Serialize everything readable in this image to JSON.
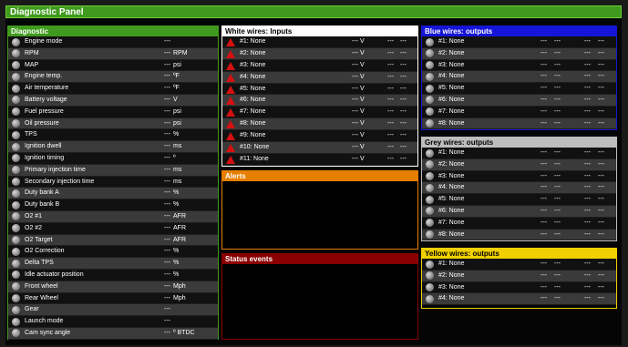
{
  "title": "Diagnostic Panel",
  "colors": {
    "green": "#3f9a1d",
    "white": "#ffffff",
    "orange": "#e67e00",
    "darkred": "#8a0000",
    "blue": "#1515d8",
    "grey": "#bdbdbd",
    "yellow": "#f0d000"
  },
  "diagnostic": {
    "title": "Diagnostic",
    "rows": [
      {
        "label": "Engine mode",
        "value": "---",
        "unit": ""
      },
      {
        "label": "RPM",
        "value": "---",
        "unit": "RPM"
      },
      {
        "label": "MAP",
        "value": "---",
        "unit": "psi"
      },
      {
        "label": "Engine temp.",
        "value": "---",
        "unit": "ºF"
      },
      {
        "label": "Air temperature",
        "value": "---",
        "unit": "ºF"
      },
      {
        "label": "Battery voltage",
        "value": "---",
        "unit": "V"
      },
      {
        "label": "Fuel pressure",
        "value": "---",
        "unit": "psi"
      },
      {
        "label": "Oil pressure",
        "value": "---",
        "unit": "psi"
      },
      {
        "label": "TPS",
        "value": "---",
        "unit": "%"
      },
      {
        "label": "Ignition dwell",
        "value": "---",
        "unit": "ms"
      },
      {
        "label": "Ignition timing",
        "value": "---",
        "unit": "º"
      },
      {
        "label": "Primary injection time",
        "value": "---",
        "unit": "ms"
      },
      {
        "label": "Secondary injection time",
        "value": "---",
        "unit": "ms"
      },
      {
        "label": "Duty bank A",
        "value": "---",
        "unit": "%"
      },
      {
        "label": "Duty bank B",
        "value": "---",
        "unit": "%"
      },
      {
        "label": "O2 #1",
        "value": "---",
        "unit": "AFR"
      },
      {
        "label": "O2 #2",
        "value": "---",
        "unit": "AFR"
      },
      {
        "label": "O2 Target",
        "value": "---",
        "unit": "AFR"
      },
      {
        "label": "O2 Correction",
        "value": "---",
        "unit": "%"
      },
      {
        "label": "Delta TPS",
        "value": "---",
        "unit": "%"
      },
      {
        "label": "Idle actuator position",
        "value": "---",
        "unit": "%"
      },
      {
        "label": "Front wheel",
        "value": "---",
        "unit": "Mph"
      },
      {
        "label": "Rear Wheel",
        "value": "---",
        "unit": "Mph"
      },
      {
        "label": "Gear",
        "value": "---",
        "unit": ""
      },
      {
        "label": "Launch mode",
        "value": "---",
        "unit": ""
      },
      {
        "label": "Cam sync angle",
        "value": "---",
        "unit": "º BTDC"
      }
    ]
  },
  "white_wires": {
    "title": "White wires: Inputs",
    "rows": [
      {
        "label": "#1: None",
        "v": "--- V",
        "a": "---",
        "b": "---"
      },
      {
        "label": "#2: None",
        "v": "--- V",
        "a": "---",
        "b": "---"
      },
      {
        "label": "#3: None",
        "v": "--- V",
        "a": "---",
        "b": "---"
      },
      {
        "label": "#4: None",
        "v": "--- V",
        "a": "---",
        "b": "---"
      },
      {
        "label": "#5: None",
        "v": "--- V",
        "a": "---",
        "b": "---"
      },
      {
        "label": "#6: None",
        "v": "--- V",
        "a": "---",
        "b": "---"
      },
      {
        "label": "#7: None",
        "v": "--- V",
        "a": "---",
        "b": "---"
      },
      {
        "label": "#8: None",
        "v": "--- V",
        "a": "---",
        "b": "---"
      },
      {
        "label": "#9: None",
        "v": "--- V",
        "a": "---",
        "b": "---"
      },
      {
        "label": "#10: None",
        "v": "--- V",
        "a": "---",
        "b": "---"
      },
      {
        "label": "#11: None",
        "v": "--- V",
        "a": "---",
        "b": "---"
      }
    ]
  },
  "alerts": {
    "title": "Alerts"
  },
  "status_events": {
    "title": "Status events"
  },
  "blue_wires": {
    "title": "Blue wires: outputs",
    "rows": [
      {
        "label": "#1: None",
        "a": "---",
        "b": "---",
        "c": "---",
        "d": "---"
      },
      {
        "label": "#2: None",
        "a": "---",
        "b": "---",
        "c": "---",
        "d": "---"
      },
      {
        "label": "#3: None",
        "a": "---",
        "b": "---",
        "c": "---",
        "d": "---"
      },
      {
        "label": "#4: None",
        "a": "---",
        "b": "---",
        "c": "---",
        "d": "---"
      },
      {
        "label": "#5: None",
        "a": "---",
        "b": "---",
        "c": "---",
        "d": "---"
      },
      {
        "label": "#6: None",
        "a": "---",
        "b": "---",
        "c": "---",
        "d": "---"
      },
      {
        "label": "#7: None",
        "a": "---",
        "b": "---",
        "c": "---",
        "d": "---"
      },
      {
        "label": "#8: None",
        "a": "---",
        "b": "---",
        "c": "---",
        "d": "---"
      }
    ]
  },
  "grey_wires": {
    "title": "Grey wires: outputs",
    "rows": [
      {
        "label": "#1: None",
        "a": "---",
        "b": "---",
        "c": "---",
        "d": "---"
      },
      {
        "label": "#2: None",
        "a": "---",
        "b": "---",
        "c": "---",
        "d": "---"
      },
      {
        "label": "#3: None",
        "a": "---",
        "b": "---",
        "c": "---",
        "d": "---"
      },
      {
        "label": "#4: None",
        "a": "---",
        "b": "---",
        "c": "---",
        "d": "---"
      },
      {
        "label": "#5: None",
        "a": "---",
        "b": "---",
        "c": "---",
        "d": "---"
      },
      {
        "label": "#6: None",
        "a": "---",
        "b": "---",
        "c": "---",
        "d": "---"
      },
      {
        "label": "#7: None",
        "a": "---",
        "b": "---",
        "c": "---",
        "d": "---"
      },
      {
        "label": "#8: None",
        "a": "---",
        "b": "---",
        "c": "---",
        "d": "---"
      }
    ]
  },
  "yellow_wires": {
    "title": "Yellow wires: outputs",
    "rows": [
      {
        "label": "#1: None",
        "a": "---",
        "b": "---",
        "c": "---",
        "d": "---"
      },
      {
        "label": "#2: None",
        "a": "---",
        "b": "---",
        "c": "---",
        "d": "---"
      },
      {
        "label": "#3: None",
        "a": "---",
        "b": "---",
        "c": "---",
        "d": "---"
      },
      {
        "label": "#4: None",
        "a": "---",
        "b": "---",
        "c": "---",
        "d": "---"
      }
    ]
  }
}
